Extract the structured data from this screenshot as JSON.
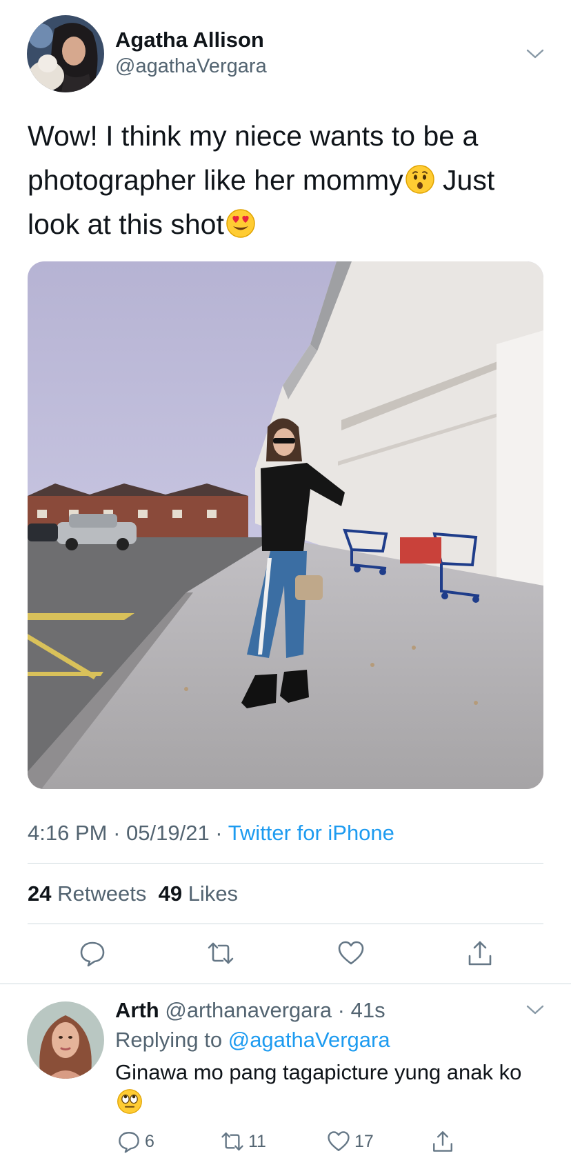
{
  "tweet": {
    "author_name": "Agatha Allison",
    "author_handle": "@agathaVergara",
    "text_part1": "Wow! I think my niece wants to be a photographer like her mommy",
    "text_part2": " Just look at this shot",
    "emoji_1": "hushed-face-emoji",
    "emoji_2": "heart-eyes-emoji",
    "time": "4:16 PM",
    "date": "05/19/21",
    "separator": " · ",
    "via": "Twitter for iPhone",
    "retweets_count": "24",
    "retweets_label": "Retweets",
    "likes_count": "49",
    "likes_label": "Likes"
  },
  "actions": [
    "reply-icon",
    "retweet-icon",
    "like-icon",
    "share-icon"
  ],
  "reply": {
    "author_name": "Arth",
    "author_handle": "@arthanavergara",
    "age": "41s",
    "replying_label": "Replying to",
    "replying_to": "@agathaVergara",
    "text": "Ginawa mo pang tagapicture yung anak ko",
    "emoji": "rolling-eyes-emoji",
    "reply_count": "6",
    "retweet_count": "11",
    "like_count": "17"
  },
  "colors": {
    "accent": "#1d9bf0",
    "secondary_text": "#536471",
    "divider": "#cfd9de"
  }
}
